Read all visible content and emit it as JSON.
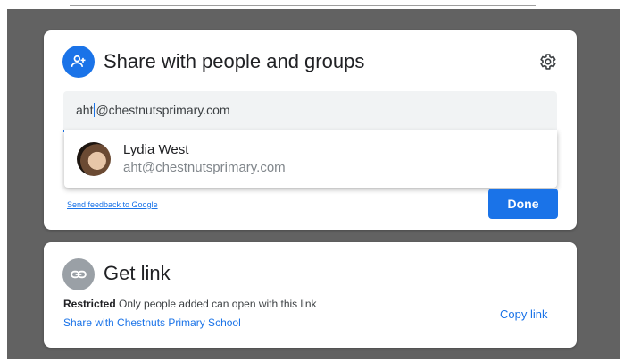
{
  "share_dialog": {
    "title": "Share with people and groups",
    "input": {
      "typed": "aht",
      "suggestion_completion": "@chestnutsprimary.com"
    },
    "suggestion": {
      "name": "Lydia West",
      "email": "aht@chestnutsprimary.com"
    },
    "feedback_link": "Send feedback to Google",
    "done_label": "Done"
  },
  "get_link": {
    "title": "Get link",
    "restriction_label": "Restricted",
    "restriction_desc": "Only people added can open with this link",
    "share_org_link": "Share with Chestnuts Primary School",
    "copy_link_label": "Copy link"
  },
  "colors": {
    "accent": "#1a73e8",
    "overlay": "#626262",
    "link_icon_bg": "#9aa0a6"
  },
  "icons": [
    "person-add-icon",
    "gear-icon",
    "link-icon"
  ]
}
